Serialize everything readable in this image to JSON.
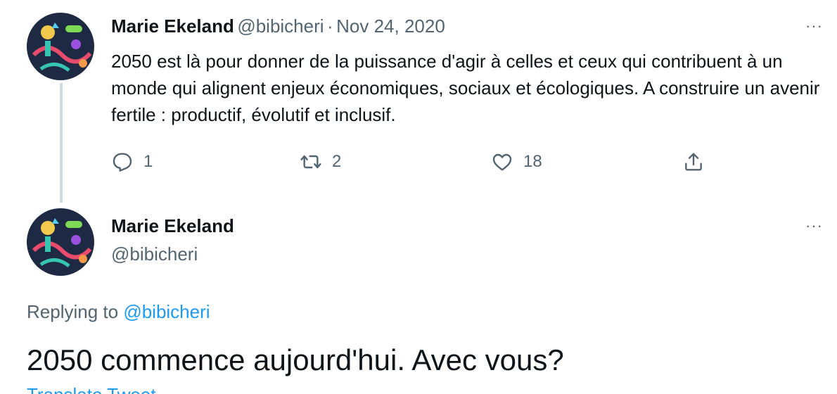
{
  "tweet1": {
    "name": "Marie Ekeland",
    "handle": "@bibicheri",
    "separator": "·",
    "date": "Nov 24, 2020",
    "text": "2050 est là pour donner de la puissance d'agir à celles et ceux qui contribuent à un monde qui alignent enjeux économiques, sociaux et écologiques. A construire un avenir fertile : productif, évolutif et inclusif.",
    "more_label": "···",
    "actions": {
      "reply_icon": "reply-icon",
      "reply_count": "1",
      "retweet_icon": "retweet-icon",
      "retweet_count": "2",
      "like_icon": "like-icon",
      "like_count": "18",
      "share_icon": "share-icon"
    }
  },
  "tweet2": {
    "name": "Marie Ekeland",
    "handle": "@bibicheri",
    "more_label": "···",
    "replying_prefix": "Replying to",
    "replying_to": "@bibicheri",
    "text": "2050 commence aujourd'hui. Avec vous?",
    "partial_link": "Translate Tweet"
  },
  "colors": {
    "text_primary": "#0f1419",
    "text_secondary": "#536471",
    "link": "#1d9bf0",
    "thread_line": "#cfd9de"
  }
}
